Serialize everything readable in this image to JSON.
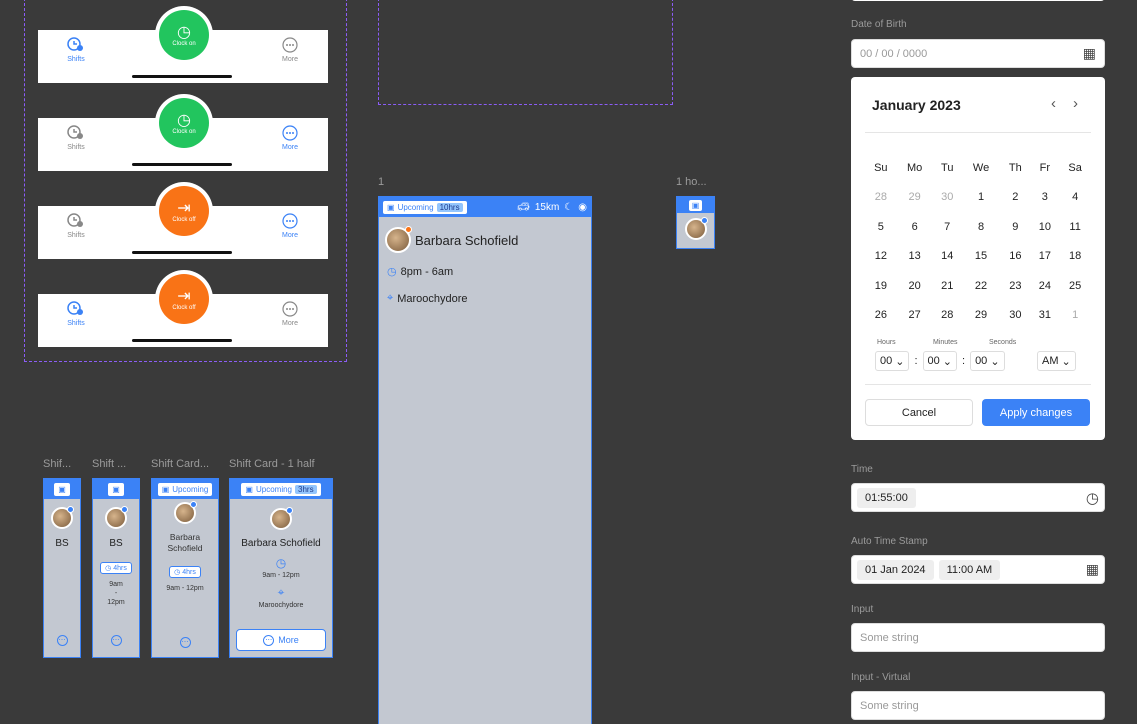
{
  "navbars": [
    {
      "left_label": "Shifts",
      "left_active": true,
      "right_label": "More",
      "right_active": false,
      "action": "Clock on",
      "action_color": "green"
    },
    {
      "left_label": "Shifts",
      "left_active": false,
      "right_label": "More",
      "right_active": true,
      "action": "Clock on",
      "action_color": "green"
    },
    {
      "left_label": "Shifts",
      "left_active": false,
      "right_label": "More",
      "right_active": true,
      "action": "Clock off",
      "action_color": "orange"
    },
    {
      "left_label": "Shifts",
      "left_active": true,
      "right_label": "More",
      "right_active": false,
      "action": "Clock off",
      "action_color": "orange"
    }
  ],
  "frame_labels": {
    "large": "1",
    "mini": "1 ho...",
    "c1": "Shif...",
    "c2": "Shift ...",
    "c3": "Shift Card...",
    "c4": "Shift Card - 1 half"
  },
  "large_card": {
    "status": "Upcoming",
    "hours": "10hrs",
    "distance": "15km",
    "name": "Barbara Schofield",
    "time": "8pm - 6am",
    "location": "Maroochydore"
  },
  "cards": {
    "c1": {
      "initials": "BS"
    },
    "c2": {
      "initials": "BS",
      "hours": "4hrs",
      "start": "9am",
      "dash": "-",
      "end": "12pm"
    },
    "c3": {
      "status": "Upcoming",
      "first": "Barbara",
      "last": "Schofield",
      "hours": "4hrs",
      "time": "9am - 12pm"
    },
    "c4": {
      "status": "Upcoming",
      "hours": "3hrs",
      "name": "Barbara Schofield",
      "time": "9am - 12pm",
      "location": "Maroochydore",
      "more": "More"
    }
  },
  "dob": {
    "label": "Date of Birth",
    "placeholder": "00 / 00 / 0000"
  },
  "calendar": {
    "month": "January 2023",
    "weekdays": [
      "Su",
      "Mo",
      "Tu",
      "We",
      "Th",
      "Fr",
      "Sa"
    ],
    "weeks": [
      [
        "28",
        "29",
        "30",
        "1",
        "2",
        "3",
        "4"
      ],
      [
        "5",
        "6",
        "7",
        "8",
        "9",
        "10",
        "11"
      ],
      [
        "12",
        "13",
        "14",
        "15",
        "16",
        "17",
        "18"
      ],
      [
        "19",
        "20",
        "21",
        "22",
        "23",
        "24",
        "25"
      ],
      [
        "26",
        "27",
        "28",
        "29",
        "30",
        "31",
        "1"
      ]
    ],
    "hours_label": "Hours",
    "minutes_label": "Minutes",
    "seconds_label": "Seconds",
    "hours": "00",
    "minutes": "00",
    "seconds": "00",
    "ampm": "AM",
    "sep": ":",
    "cancel": "Cancel",
    "apply": "Apply changes"
  },
  "time": {
    "label": "Time",
    "value": "01:55:00"
  },
  "auto": {
    "label": "Auto Time Stamp",
    "date": "01 Jan 2024",
    "time": "11:00 AM"
  },
  "input": {
    "label": "Input",
    "placeholder": "Some string"
  },
  "input_virtual": {
    "label": "Input - Virtual",
    "placeholder": "Some string"
  },
  "colors": {
    "accent": "#3b82f6",
    "green": "#22c55e",
    "orange": "#f97316"
  }
}
